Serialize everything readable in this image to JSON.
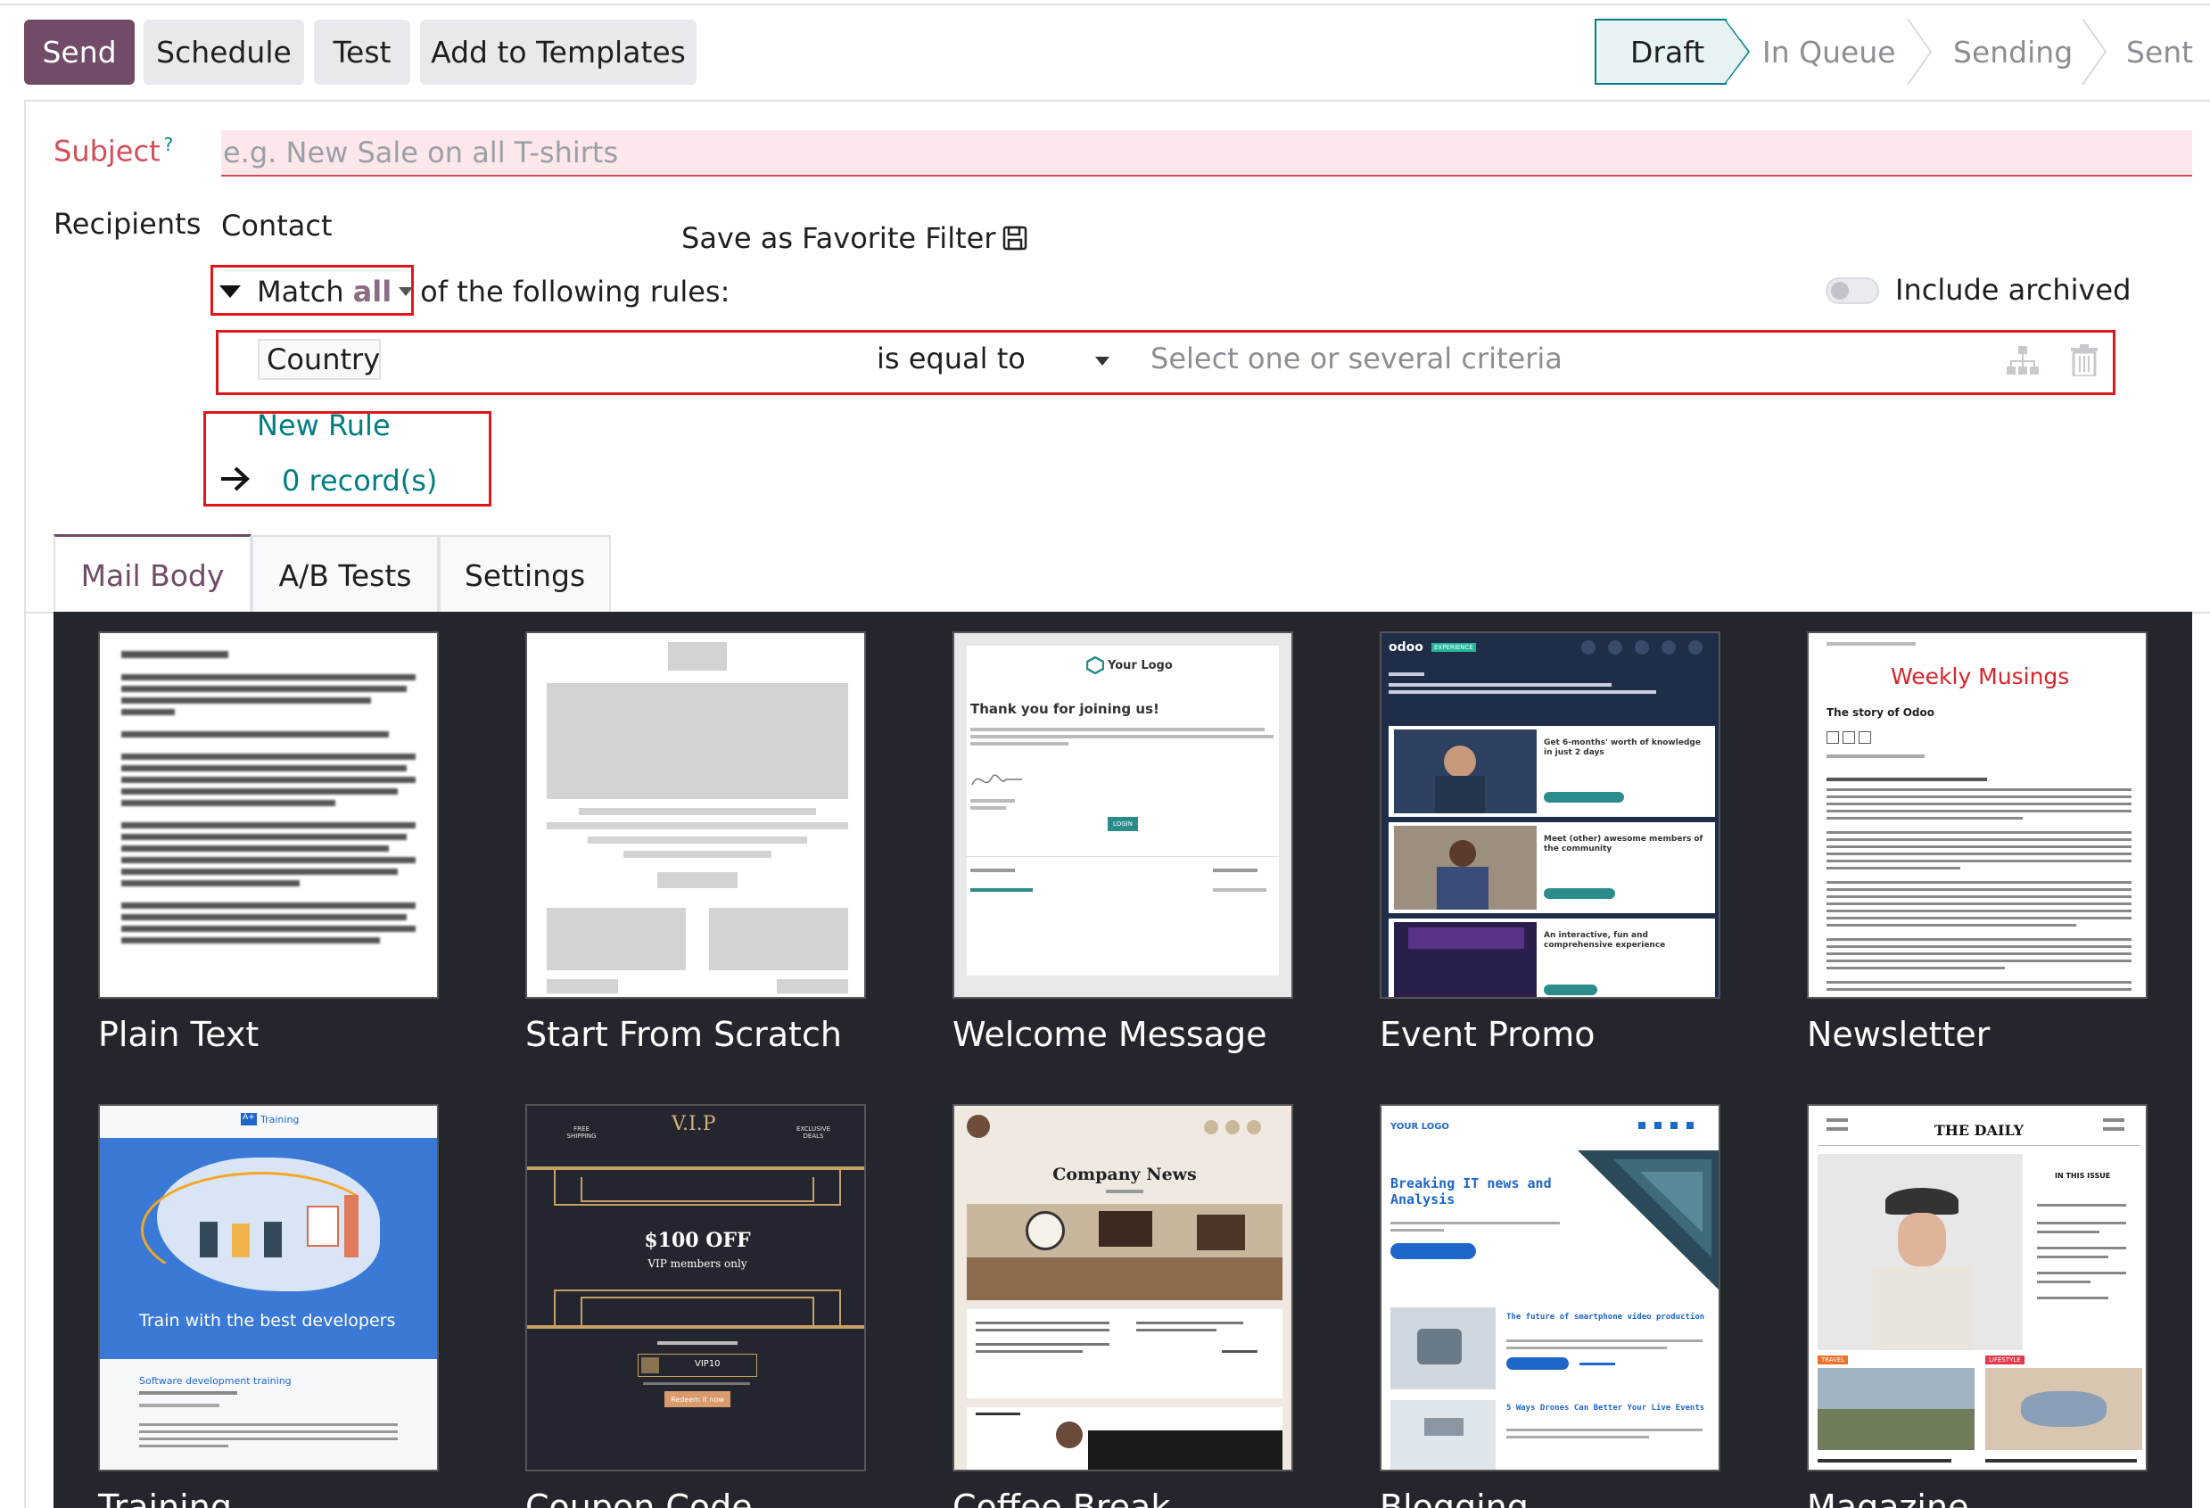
{
  "toolbar": {
    "send": "Send",
    "schedule": "Schedule",
    "test": "Test",
    "add_to_templates": "Add to Templates"
  },
  "statusbar": {
    "stages": [
      "Draft",
      "In Queue",
      "Sending",
      "Sent"
    ],
    "active": "Draft"
  },
  "form": {
    "subject_label": "Subject",
    "subject_help": "?",
    "subject_placeholder": "e.g. New Sale on all T-shirts",
    "recipients_label": "Recipients",
    "recipients_model": "Contact",
    "save_favorite": "Save as Favorite Filter",
    "match_prefix": "Match",
    "match_value": "all",
    "match_suffix": "of the following rules:",
    "include_archived": "Include archived",
    "rule": {
      "field": "Country",
      "operator": "is equal to",
      "value_placeholder": "Select one or several criteria"
    },
    "new_rule": "New Rule",
    "records": "0 record(s)"
  },
  "tabs": [
    "Mail Body",
    "A/B Tests",
    "Settings"
  ],
  "templates": [
    {
      "name": "Plain Text"
    },
    {
      "name": "Start From Scratch"
    },
    {
      "name": "Welcome Message"
    },
    {
      "name": "Event Promo"
    },
    {
      "name": "Newsletter"
    },
    {
      "name": "Training"
    },
    {
      "name": "Coupon Code"
    },
    {
      "name": "Coffee Break"
    },
    {
      "name": "Blogging"
    },
    {
      "name": "Magazine"
    }
  ],
  "thumbs": {
    "welcome_logo": "Your Logo",
    "welcome_thanks": "Thank you for joining us!",
    "welcome_login": "LOGIN",
    "event_brand": "odoo",
    "event_tag": "EXPERIENCE",
    "event_item1": "Get 6-months' worth of knowledge in just 2 days",
    "event_item2": "Meet (other) awesome members of the community",
    "event_item3": "An interactive, fun and comprehensive experience",
    "news_title": "Weekly Musings",
    "news_story": "The story of Odoo",
    "training_brand": "Training",
    "training_banner": "Train with the best developers",
    "training_sub": "Software development training",
    "coupon_free": "FREE SHIPPING",
    "coupon_vip": "V.I.P",
    "coupon_excl": "EXCLUSIVE DEALS",
    "coupon_offer": "$100 OFF",
    "coupon_members": "VIP members only",
    "coupon_code": "VIP10",
    "coupon_redeem": "Redeem it now",
    "coffee_title": "Company News",
    "blog_logo": "YOUR LOGO",
    "blog_title": "Breaking IT news and Analysis",
    "blog_item1": "The future of smartphone video production",
    "blog_item2": "5 Ways Drones Can Better Your Live Events",
    "mag_title": "THE DAILY",
    "mag_issue": "IN THIS ISSUE",
    "mag_travel": "TRAVEL",
    "mag_lifestyle": "LIFESTYLE"
  },
  "colors": {
    "primary": "#714b67",
    "accent": "#017e84",
    "required": "#d44c59",
    "gallery_bg": "#24262d",
    "highlight_box": "#e0161b"
  }
}
